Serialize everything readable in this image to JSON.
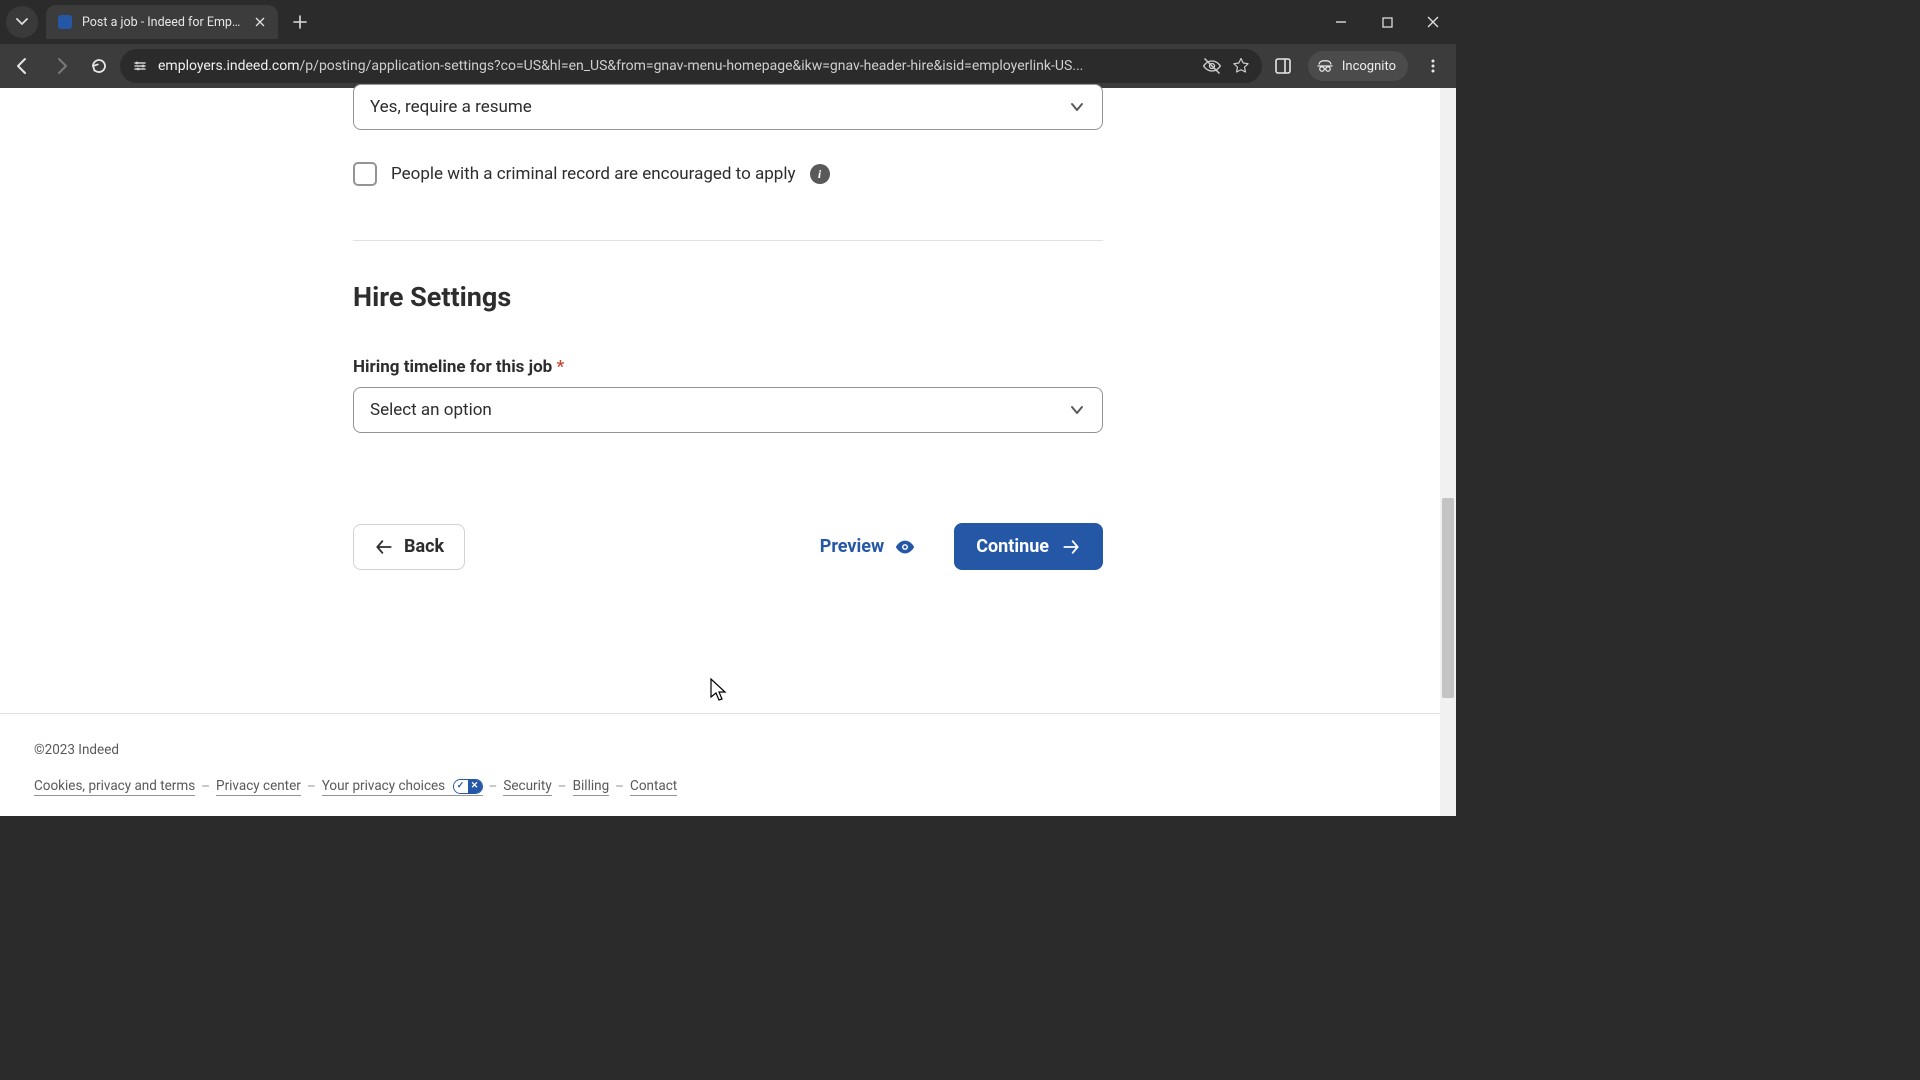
{
  "browser": {
    "tab_title": "Post a job - Indeed for Employe",
    "url_display_domain": "employers.indeed.com",
    "url_display_path": "/p/posting/application-settings?co=US&hl=en_US&from=gnav-menu-homepage&ikw=gnav-header-hire&isid=employerlink-US...",
    "incognito_label": "Incognito"
  },
  "form": {
    "resume_select_value": "Yes, require a resume",
    "criminal_record_label": "People with a criminal record are encouraged to apply",
    "hire_settings_heading": "Hire Settings",
    "timeline_label": "Hiring timeline for this job",
    "timeline_select_value": "Select an option",
    "back_label": "Back",
    "preview_label": "Preview",
    "continue_label": "Continue"
  },
  "footer": {
    "copyright": "©2023 Indeed",
    "links": {
      "cookies": "Cookies, privacy and terms",
      "privacy_center": "Privacy center",
      "your_choices": "Your privacy choices",
      "security": "Security",
      "billing": "Billing",
      "contact": "Contact"
    }
  }
}
